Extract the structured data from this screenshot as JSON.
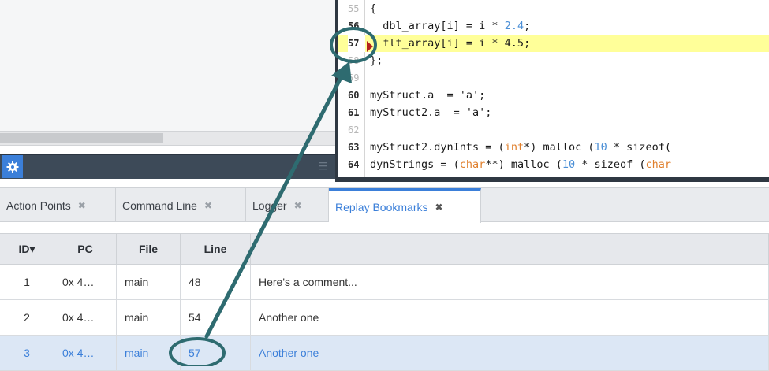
{
  "code": {
    "lines": [
      {
        "no": "55",
        "dim": true,
        "html": "{"
      },
      {
        "no": "56",
        "dim": false,
        "html": "  dbl_array[i] = i * <span class=\"num\">2.4</span>;"
      },
      {
        "no": "57",
        "dim": false,
        "html": "  flt_array[i] = i * 4.5;"
      },
      {
        "no": "58",
        "dim": true,
        "html": "};"
      },
      {
        "no": "59",
        "dim": true,
        "html": ""
      },
      {
        "no": "60",
        "dim": false,
        "html": "myStruct.a  = 'a';"
      },
      {
        "no": "61",
        "dim": false,
        "html": "myStruct2.a  = 'a';"
      },
      {
        "no": "62",
        "dim": true,
        "html": ""
      },
      {
        "no": "63",
        "dim": false,
        "html": "myStruct2.dynInts = (<span class=\"kw\">int</span>*) malloc (<span class=\"num\">10</span> * sizeof("
      },
      {
        "no": "64",
        "dim": false,
        "html": "dynStrings = (<span class=\"kw\">char</span>**) malloc (<span class=\"num\">10</span> * sizeof (<span class=\"kw\">char</span>"
      }
    ],
    "current_line": "57"
  },
  "tabs": [
    {
      "label": "Action Points",
      "close": "✖"
    },
    {
      "label": "Command Line",
      "close": "✖"
    },
    {
      "label": "Logger",
      "close": "✖"
    },
    {
      "label": "Replay Bookmarks",
      "close": "✖"
    }
  ],
  "table": {
    "columns": [
      "ID",
      "PC",
      "File",
      "Line",
      ""
    ],
    "sort_indicator": "▾",
    "rows": [
      {
        "id": "1",
        "pc": "0x 4…",
        "file": "main",
        "line": "48",
        "comment": "Here's a comment..."
      },
      {
        "id": "2",
        "pc": "0x 4…",
        "file": "main",
        "line": "54",
        "comment": "Another one"
      },
      {
        "id": "3",
        "pc": "0x 4…",
        "file": "main",
        "line": "57",
        "comment": "Another one"
      }
    ],
    "selected_row": 2
  },
  "colors": {
    "accent": "#3b7fd9",
    "annotation": "#2e6b70",
    "current_line_highlight": "#ffff99",
    "breakpoint": "#b3221e"
  },
  "icons": {
    "settings": "gear-icon",
    "grip": "grip-icon",
    "breakpoint": "breakpoint-marker-icon"
  }
}
